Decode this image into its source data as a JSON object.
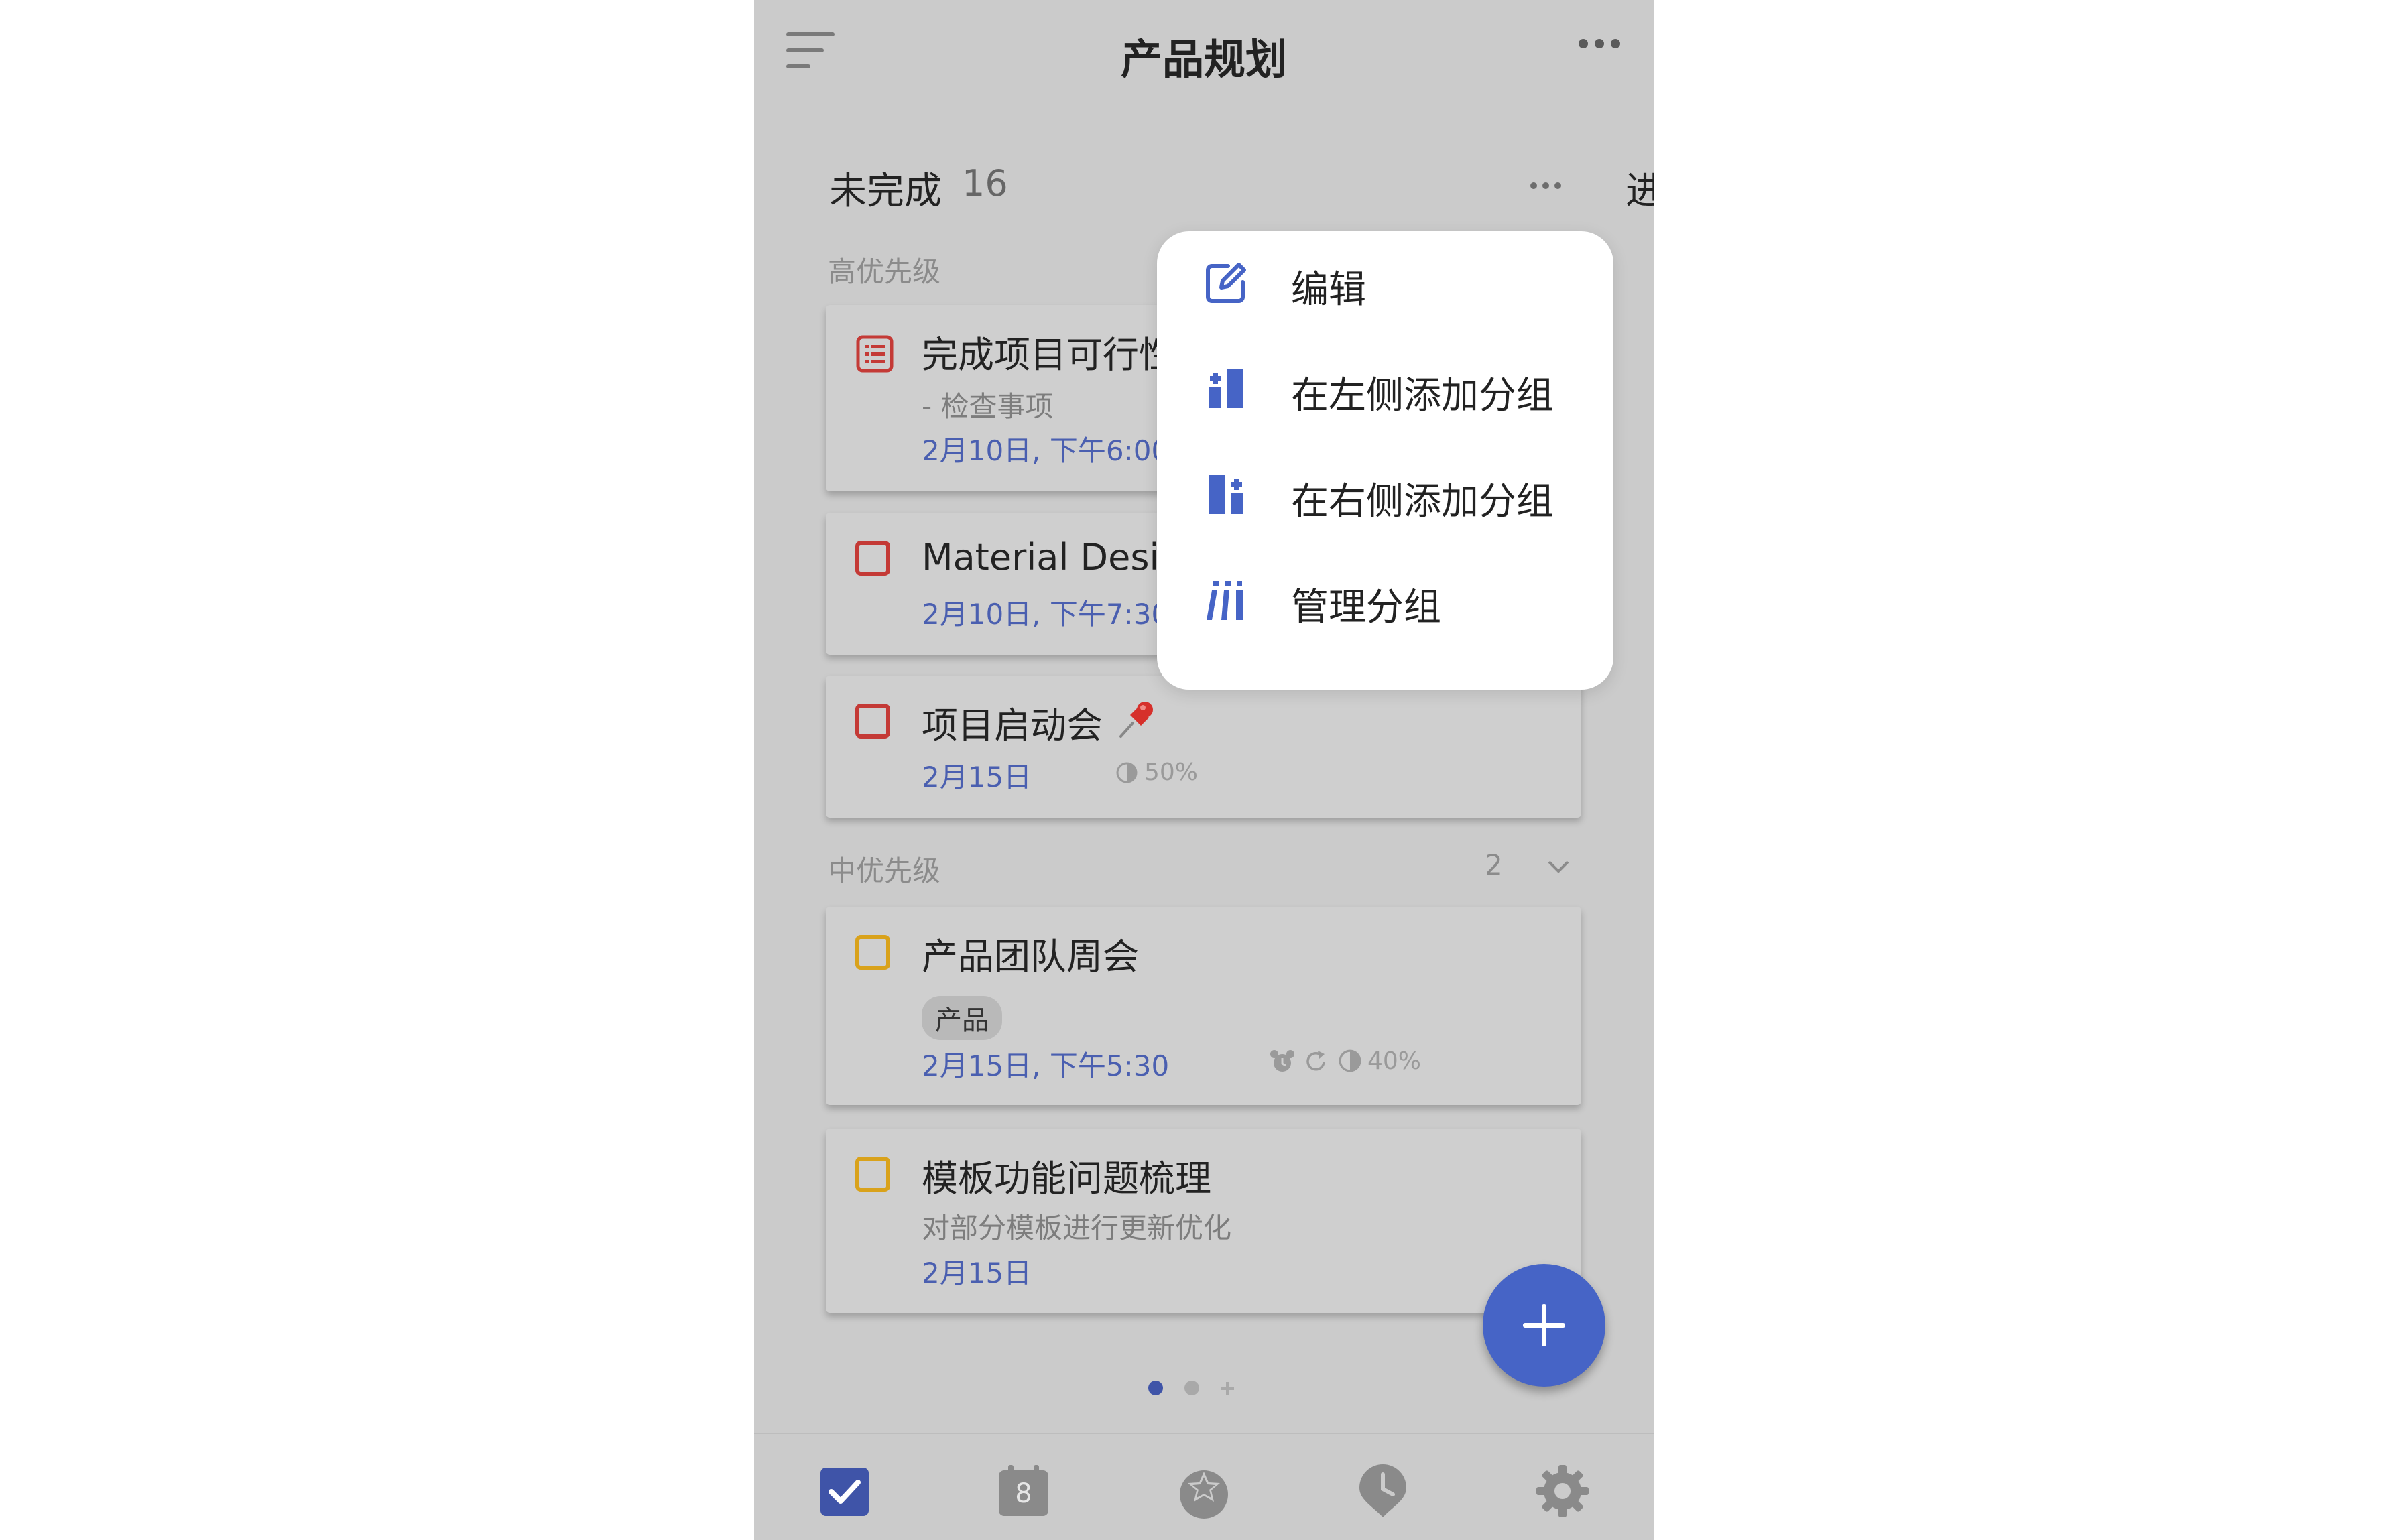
{
  "header": {
    "title": "产品规划"
  },
  "column": {
    "title": "未完成",
    "count": "16",
    "next_title": "进"
  },
  "sections": {
    "high": {
      "label": "高优先级"
    },
    "medium": {
      "label": "中优先级",
      "count": "2"
    }
  },
  "tasks": [
    {
      "title": "完成项目可行性",
      "subtitle": "- 检查事项",
      "date": "2月10日, 下午6:00",
      "checkbox_color": "#c43a36",
      "icon": "checklist-icon"
    },
    {
      "title": "Material Design",
      "date": "2月10日, 下午7:30",
      "checkbox_color": "#c43a36"
    },
    {
      "title": "项目启动会",
      "date": "2月15日",
      "progress": "50%",
      "checkbox_color": "#c43a36",
      "emoji": "pushpin"
    },
    {
      "title": "产品团队周会",
      "tag": "产品",
      "date": "2月15日, 下午5:30",
      "progress": "40%",
      "checkbox_color": "#d9a21b"
    },
    {
      "title": "模板功能问题梳理",
      "subtitle": "对部分模板进行更新优化",
      "date": "2月15日",
      "checkbox_color": "#d9a21b"
    }
  ],
  "menu": {
    "items": [
      {
        "label": "编辑",
        "icon": "edit-icon"
      },
      {
        "label": "在左侧添加分组",
        "icon": "add-left-group-icon"
      },
      {
        "label": "在右侧添加分组",
        "icon": "add-right-group-icon"
      },
      {
        "label": "管理分组",
        "icon": "manage-groups-icon"
      }
    ]
  },
  "bottom_nav": {
    "calendar_day": "8",
    "items": [
      "tasks-icon",
      "calendar-icon",
      "habit-icon",
      "pomodoro-icon",
      "settings-icon"
    ]
  },
  "colors": {
    "accent": "#4664c6",
    "high_priority": "#c43a36",
    "medium_priority": "#d9a21b",
    "date_text": "#4a5fb0"
  }
}
